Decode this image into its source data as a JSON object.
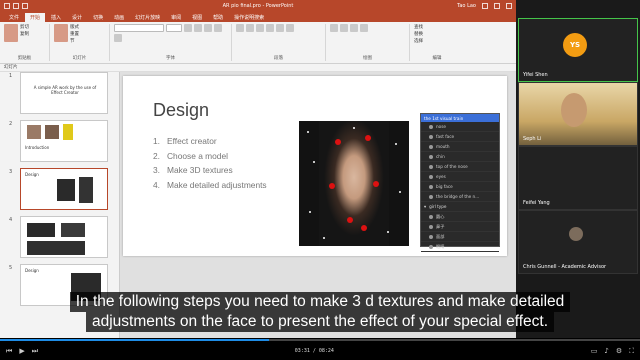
{
  "ppt": {
    "window_title": "AR pio final.pro - PowerPoint",
    "account": "Tao Lao",
    "tabs": [
      "文件",
      "开始",
      "插入",
      "设计",
      "切换",
      "动画",
      "幻灯片放映",
      "审阅",
      "视图",
      "帮助"
    ],
    "active_tab": "开始",
    "tell_me": "操作说明搜索",
    "groups": [
      "剪贴板",
      "幻灯片",
      "字体",
      "段落",
      "绘图",
      "编辑"
    ],
    "ribbon_items": {
      "paste": "粘贴",
      "cut": "剪切",
      "copy": "复制",
      "new_slide": "新建幻灯片",
      "layout": "版式",
      "reset": "重置",
      "section": "节",
      "find": "查找",
      "replace": "替换",
      "select": "选择"
    },
    "status": "幻灯片",
    "accent": "#b7472a"
  },
  "thumbnails": [
    {
      "num": "1",
      "text": "A simple AR work by the use of Effect Creator"
    },
    {
      "num": "2",
      "text": "Introduction"
    },
    {
      "num": "3",
      "text": "Design",
      "active": true
    },
    {
      "num": "4",
      "text": ""
    },
    {
      "num": "5",
      "text": "Design"
    }
  ],
  "slide": {
    "title": "Design",
    "bullets": [
      {
        "n": "1.",
        "t": "Effect creator"
      },
      {
        "n": "2.",
        "t": "Choose a model"
      },
      {
        "n": "3.",
        "t": "Make 3D textures"
      },
      {
        "n": "4.",
        "t": "Make detailed adjustments"
      }
    ],
    "panel": {
      "header": "the 1st visual train",
      "rows": [
        "nose",
        "fast face",
        "mouth",
        "chin",
        "top of the nose",
        "eyes",
        "big face",
        "the bridge of the n...",
        "girl type",
        "圆心",
        "鼻子",
        "面部",
        "眼睛",
        "腮红"
      ]
    }
  },
  "participants": [
    {
      "name": "Yifei Shen",
      "initials": "YS",
      "active": true
    },
    {
      "name": "Seph Li"
    },
    {
      "name": "Feifei Yang"
    },
    {
      "name": "Chris Gunnell - Academic Advisor"
    }
  ],
  "subtitles": [
    "In the following steps you need to make 3 d textures and make detailed",
    "adjustments on the face to present the effect of your special effect."
  ],
  "player": {
    "time": "03:31 / 08:24",
    "progress": 0.42
  }
}
